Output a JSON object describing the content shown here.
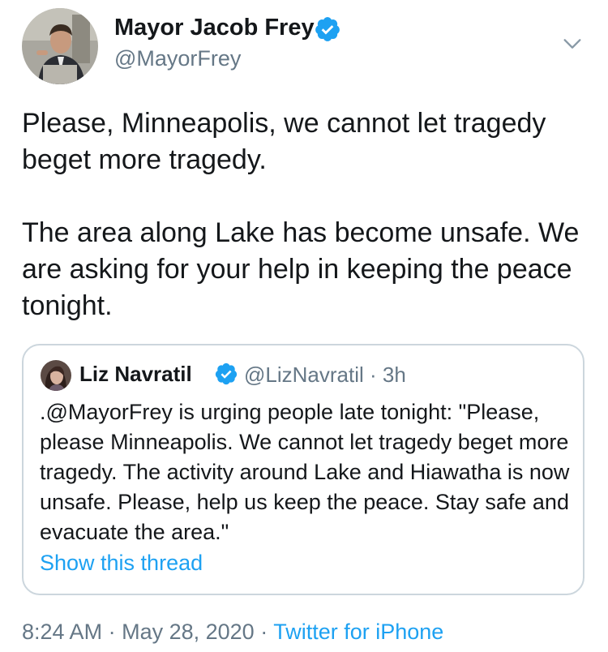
{
  "tweet": {
    "author": {
      "name": "Mayor Jacob Frey",
      "handle": "@MayorFrey",
      "verified": true
    },
    "text_paragraphs": [
      "Please, Minneapolis, we cannot let tragedy beget more tragedy.",
      "The area along Lake has become unsafe. We are asking for your help in keeping the peace tonight."
    ],
    "quoted_tweet": {
      "author_name": "Liz Navratil",
      "author_handle": "@LizNavratil",
      "separator": "·",
      "time": "3h",
      "text": ".@MayorFrey is urging people late tonight: \"Please, please Minneapolis. We cannot let tragedy beget more tragedy. The activity around Lake and Hiawatha is now unsafe. Please, help us keep the peace. Stay safe and evacuate the area.\"",
      "show_thread_label": "Show this thread"
    },
    "footer": {
      "time": "8:24 AM",
      "separator": "·",
      "date": "May 28, 2020",
      "source": "Twitter for iPhone"
    }
  },
  "colors": {
    "verified": "#1da1f2",
    "link": "#1da1f2",
    "secondary_text": "#657786",
    "border": "#ccd6dd"
  },
  "icons": {
    "verified": "verified-badge-icon",
    "caret": "chevron-down-icon"
  }
}
